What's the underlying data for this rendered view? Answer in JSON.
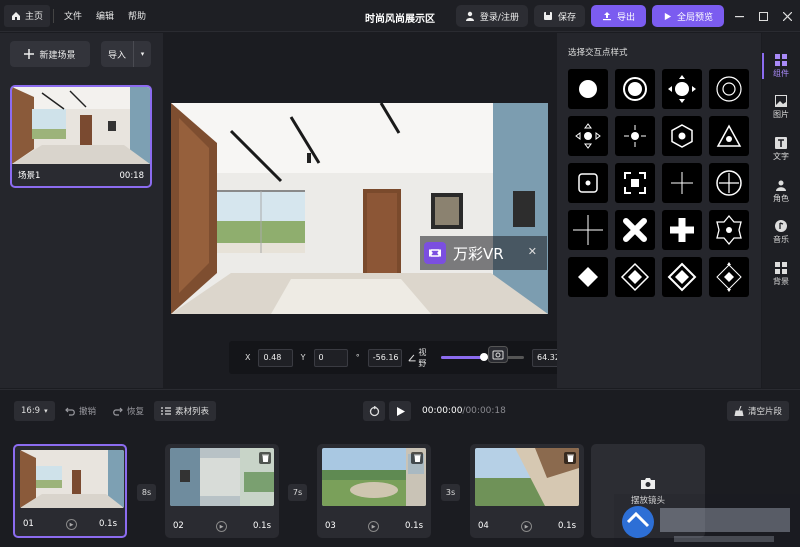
{
  "menu": {
    "home": "主页",
    "file": "文件",
    "edit": "编辑",
    "help": "帮助"
  },
  "title": "时尚风尚展示区",
  "topbar": {
    "login": "登录/注册",
    "save": "保存",
    "export": "导出",
    "preview": "全局预览"
  },
  "left": {
    "new_scene": "新建场景",
    "import": "导入",
    "scene": {
      "name": "场景1",
      "time": "00:18"
    }
  },
  "brand": {
    "text": "万彩VR"
  },
  "coords": {
    "x_label": "X",
    "x_value": "0.48",
    "y_label": "Y",
    "y_value": "0",
    "deg_symbol": "°",
    "deg_value": "-56.16",
    "fov_label": "视野",
    "fov_value": "64.32",
    "fov_fraction": 0.48
  },
  "right": {
    "title": "选择交互点样式"
  },
  "sidebar": [
    {
      "label": "组件",
      "icon": "grid-icon",
      "active": true
    },
    {
      "label": "图片",
      "icon": "image-icon"
    },
    {
      "label": "文字",
      "icon": "text-icon"
    },
    {
      "label": "角色",
      "icon": "person-icon"
    },
    {
      "label": "音乐",
      "icon": "music-icon"
    },
    {
      "label": "背景",
      "icon": "background-icon"
    }
  ],
  "bottom": {
    "ratio": "16:9",
    "undo": "撤销",
    "redo": "恢复",
    "materials": "素材列表",
    "time_current": "00:00:00",
    "time_total": "/00:00:18",
    "clear": "清空片段",
    "place_camera": "摆放镜头"
  },
  "clips": [
    {
      "num": "01",
      "dur": "0.1s"
    },
    {
      "num": "02",
      "dur": "0.1s"
    },
    {
      "num": "03",
      "dur": "0.1s"
    },
    {
      "num": "04",
      "dur": "0.1s"
    }
  ],
  "transitions": [
    "8s",
    "7s",
    "3s"
  ],
  "colors": {
    "accent": "#8c6cf0",
    "export": "#7b5cf0"
  }
}
